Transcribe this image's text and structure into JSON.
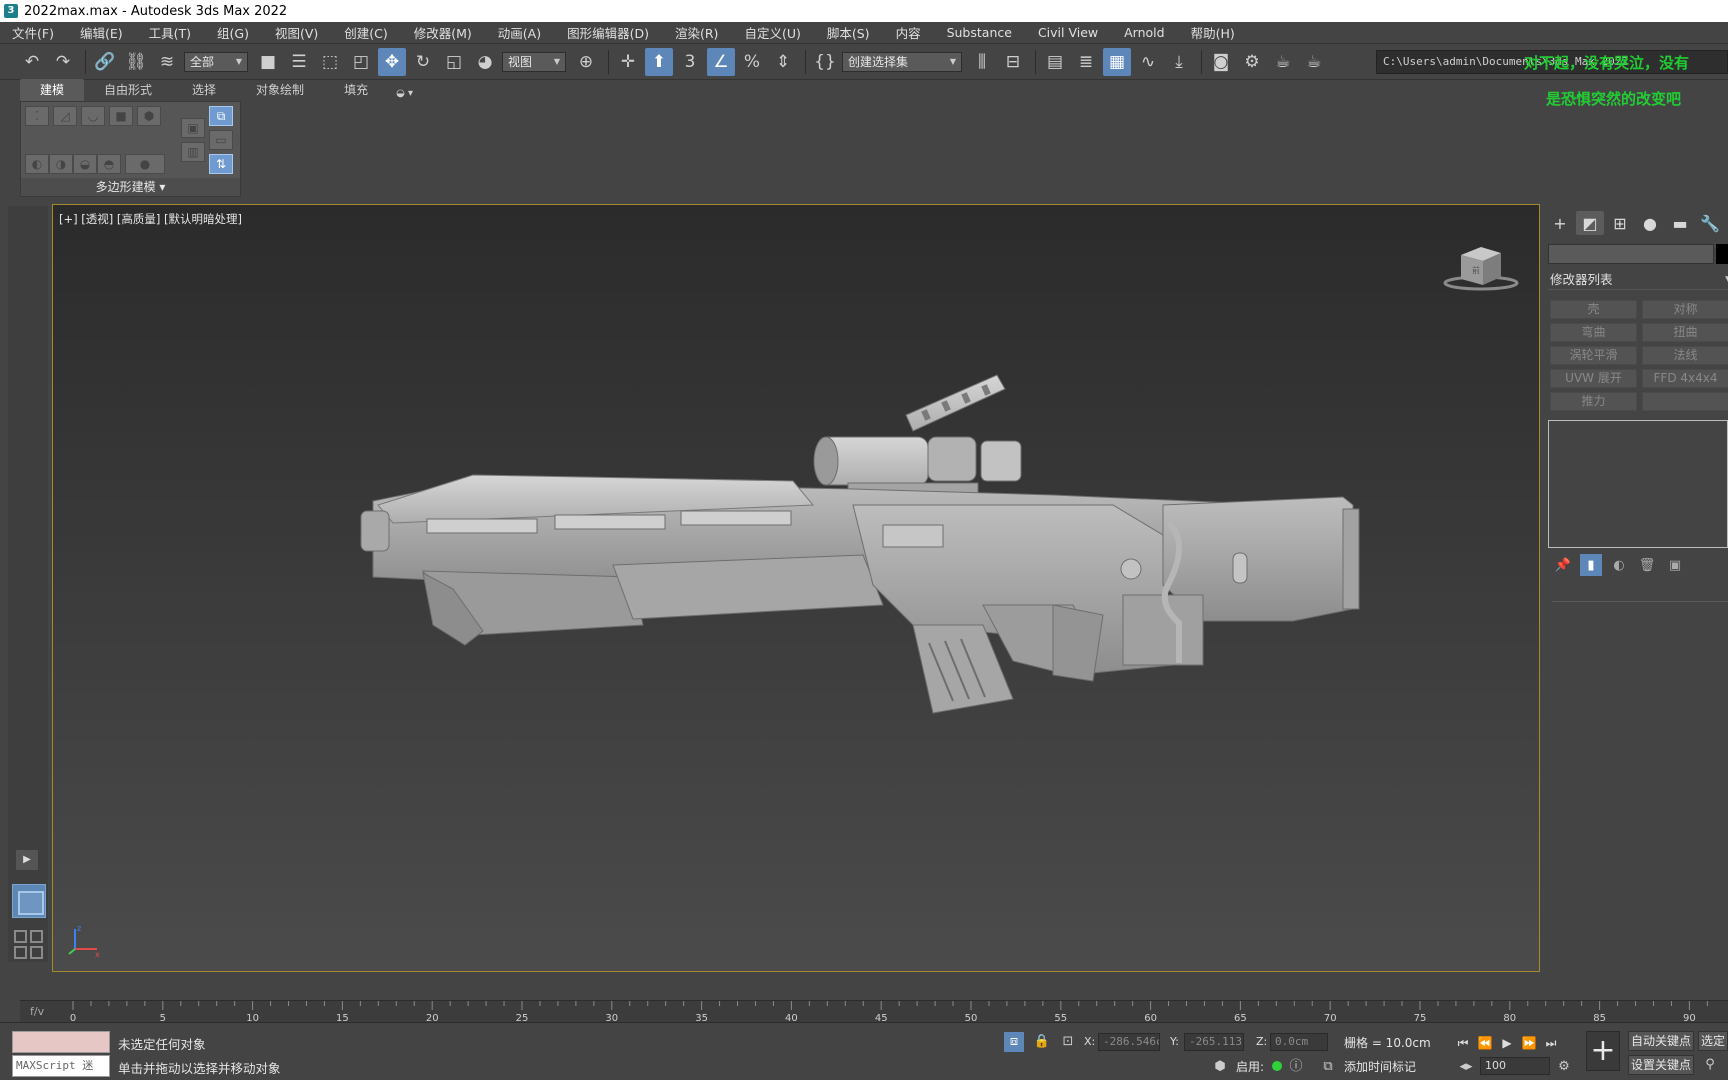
{
  "window": {
    "title": "2022max.max - Autodesk 3ds Max 2022"
  },
  "menu": [
    "文件(F)",
    "编辑(E)",
    "工具(T)",
    "组(G)",
    "视图(V)",
    "创建(C)",
    "修改器(M)",
    "动画(A)",
    "图形编辑器(D)",
    "渲染(R)",
    "自定义(U)",
    "脚本(S)",
    "内容",
    "Substance",
    "Civil View",
    "Arnold",
    "帮助(H)"
  ],
  "toolbar": {
    "filter_dropdown": "全部",
    "coord_dropdown": "视图",
    "selection_set": "创建选择集",
    "project_path": "C:\\Users\\admin\\Documents\\3ds Max 2022"
  },
  "overlay": {
    "line1": "对不起，没有哭泣，没有",
    "line2": "是恐惧突然的改变吧"
  },
  "ribbon": {
    "tabs": [
      "建模",
      "自由形式",
      "选择",
      "对象绘制",
      "填充"
    ],
    "panel_label": "多边形建模"
  },
  "viewport": {
    "label": "[+] [透视] [高质量] [默认明暗处理]",
    "viewcube_label": "前"
  },
  "command_panel": {
    "modifier_list": "修改器列表",
    "modifiers": [
      [
        "壳",
        "对称"
      ],
      [
        "弯曲",
        "扭曲"
      ],
      [
        "涡轮平滑",
        "法线"
      ],
      [
        "UVW 展开",
        "FFD 4x4x4"
      ],
      [
        "推力",
        ""
      ]
    ]
  },
  "timeline": {
    "ticks": [
      "0",
      "5",
      "10",
      "15",
      "20",
      "25",
      "30",
      "35",
      "40",
      "45",
      "50",
      "55",
      "60",
      "65",
      "70",
      "75",
      "80",
      "85",
      "90"
    ]
  },
  "status": {
    "maxscript_label": "MAXScript 迷",
    "selection_status": "未选定任何对象",
    "prompt": "单击并拖动以选择并移动对象",
    "x": "-286.546c",
    "y": "-265.113c",
    "z": "0.0cm",
    "grid": "栅格 = 10.0cm",
    "enable": "启用:",
    "time_tag": "添加时间标记",
    "frame": "100",
    "auto_key": "自动关键点",
    "set_key": "设置关键点",
    "selected": "选定"
  }
}
